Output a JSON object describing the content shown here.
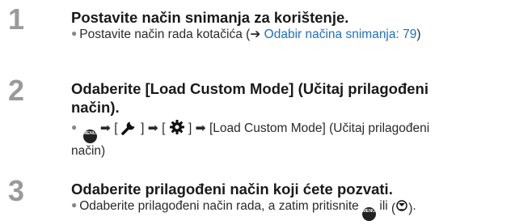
{
  "steps": [
    {
      "number": "1",
      "title": "Postavite način snimanja za korištenje.",
      "detail_prefix": "Postavite način rada kotačića (",
      "detail_arrow": "➔",
      "detail_link": "Odabir načina snimanja: 79",
      "detail_suffix": ")"
    },
    {
      "number": "2",
      "title_line1": "Odaberite [Load Custom Mode] (Učitaj prilagođeni",
      "title_line2": "način).",
      "menu_icon_text": "MENU/SET",
      "arrow": "➡",
      "bracket_open": "[",
      "bracket_close": "]",
      "detail_tail_line1": "[Load Custom Mode] (Učitaj prilagođeni",
      "detail_tail_line2": "način)",
      "icons": [
        "menu-set-button",
        "wrench-icon",
        "gear-icon"
      ]
    },
    {
      "number": "3",
      "title": "Odaberite prilagođeni način koji ćete pozvati.",
      "detail_text": "Odaberite prilagođeni način rada, a zatim pritisnite",
      "detail_or": "ili",
      "detail_end": ".",
      "icons": [
        "menu-set-button",
        "dial-press-icon"
      ]
    }
  ],
  "colors": {
    "step_number": "#9a9a9a",
    "link": "#1f6fc5",
    "text": "#1a1a1a"
  }
}
